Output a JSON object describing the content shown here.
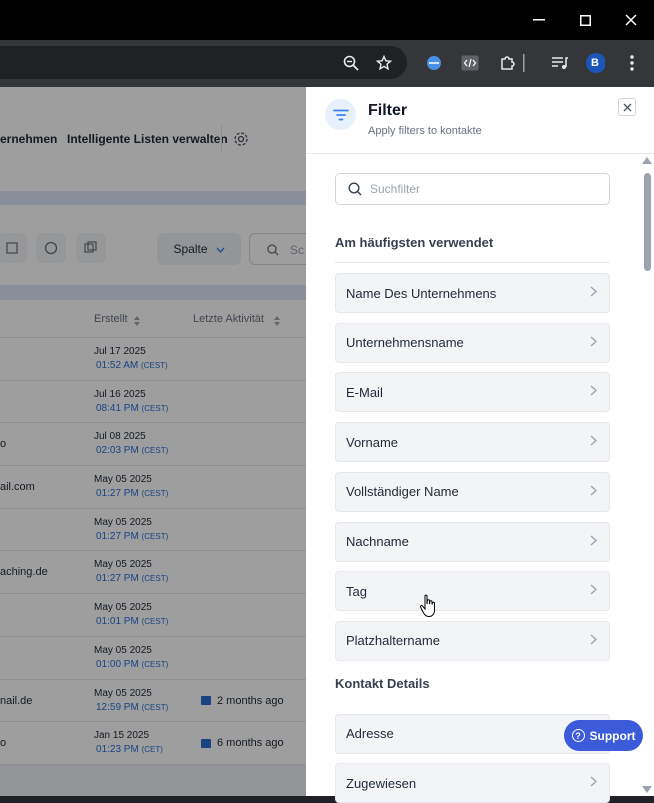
{
  "browser": {
    "window_controls": {
      "minimize": "—",
      "maximize": "☐",
      "close": "✕"
    },
    "profile_initial": "B"
  },
  "background_page": {
    "nav_items": [
      "ernehmen",
      "Intelligente Listen verwalten"
    ],
    "spalte_label": "Spalte",
    "search_placeholder": "Sc",
    "columns": {
      "erstellt": "Erstellt",
      "letzte": "Letzte Aktivität"
    },
    "rows": [
      {
        "left": "",
        "date": "Jul 17 2025",
        "time": "01:52 AM",
        "tz": "(CEST)",
        "activity": ""
      },
      {
        "left": "",
        "date": "Jul 16 2025",
        "time": "08:41 PM",
        "tz": "(CEST)",
        "activity": ""
      },
      {
        "left": "o",
        "date": "Jul 08 2025",
        "time": "02:03 PM",
        "tz": "(CEST)",
        "activity": ""
      },
      {
        "left": "ail.com",
        "date": "May 05 2025",
        "time": "01:27 PM",
        "tz": "(CEST)",
        "activity": ""
      },
      {
        "left": "",
        "date": "May 05 2025",
        "time": "01:27 PM",
        "tz": "(CEST)",
        "activity": ""
      },
      {
        "left": "aching.de",
        "date": "May 05 2025",
        "time": "01:27 PM",
        "tz": "(CEST)",
        "activity": ""
      },
      {
        "left": "",
        "date": "May 05 2025",
        "time": "01:01 PM",
        "tz": "(CEST)",
        "activity": ""
      },
      {
        "left": "",
        "date": "May 05 2025",
        "time": "01:00 PM",
        "tz": "(CEST)",
        "activity": ""
      },
      {
        "left": "nail.de",
        "date": "May 05 2025",
        "time": "12:59 PM",
        "tz": "(CEST)",
        "activity": "2 months ago"
      },
      {
        "left": "o",
        "date": "Jan 15 2025",
        "time": "01:23 PM",
        "tz": "(CET)",
        "activity": "6 months ago"
      }
    ]
  },
  "filter_panel": {
    "title": "Filter",
    "subtitle": "Apply filters to kontakte",
    "search_placeholder": "Suchfilter",
    "sections": [
      {
        "heading": "Am häufigsten verwendet",
        "items": [
          "Name Des Unternehmens",
          "Unternehmensname",
          "E-Mail",
          "Vorname",
          "Vollständiger Name",
          "Nachname",
          "Tag",
          "Platzhaltername"
        ]
      },
      {
        "heading": "Kontakt Details",
        "items": [
          "Adresse",
          "Zugewiesen"
        ]
      }
    ]
  },
  "support_button": {
    "label": "Support"
  },
  "colors": {
    "accent": "#3b5bdb",
    "link": "#2b6cd6"
  }
}
